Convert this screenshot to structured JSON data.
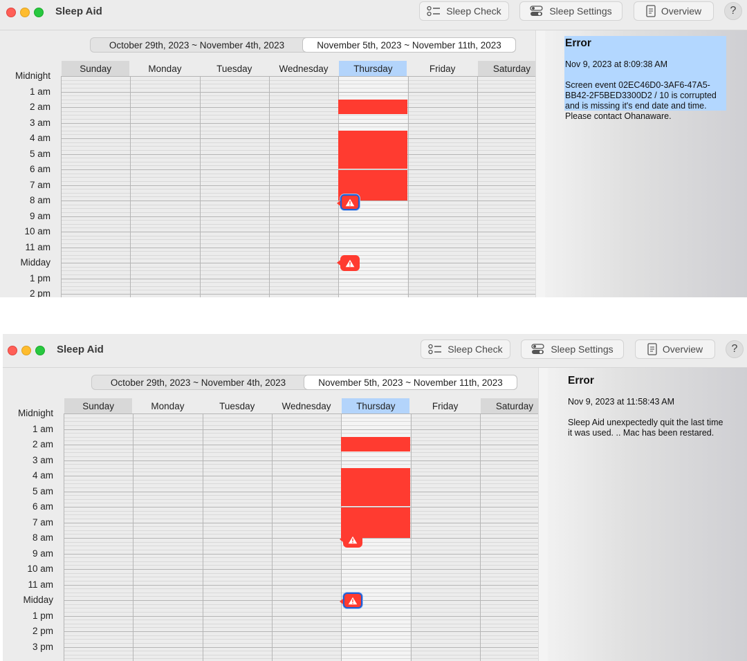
{
  "app_title": "Sleep Aid",
  "toolbar": {
    "sleep_check": "Sleep Check",
    "sleep_settings": "Sleep Settings",
    "overview": "Overview",
    "help": "?"
  },
  "weeks": [
    "October 29th, 2023 ~ November 4th, 2023",
    "November 5th, 2023 ~ November 11th, 2023"
  ],
  "selected_week": 1,
  "days": [
    "Sunday",
    "Monday",
    "Tuesday",
    "Wednesday",
    "Thursday",
    "Friday",
    "Saturday"
  ],
  "today_index": 4,
  "hours": [
    "Midnight",
    "1 am",
    "2 am",
    "3 am",
    "4 am",
    "5 am",
    "6 am",
    "7 am",
    "8 am",
    "9 am",
    "10 am",
    "11 am",
    "Midday",
    "1 pm",
    "2 pm",
    "3 pm"
  ],
  "colors": {
    "event": "#ff3b30",
    "today_header": "#b3d4fb",
    "selection": "#1d5fd6",
    "error_highlight": "#b3d7ff"
  },
  "events": [
    {
      "day": 4,
      "start_hour": 1.5,
      "end_hour": 2.45
    },
    {
      "day": 4,
      "start_hour": 3.5,
      "end_hour": 5.95
    },
    {
      "day": 4,
      "start_hour": 6.05,
      "end_hour": 8.0
    }
  ],
  "screenshots": [
    {
      "selected_warning": 0,
      "error": {
        "title": "Error",
        "date": "Nov 9, 2023 at 8:09:38 AM",
        "message": "Screen event 02EC46D0-3AF6-47A5-BB42-2F5BED3300D2 / 10 is corrupted and is missing it's end date and time. Please contact Ohanaware.",
        "highlighted": true
      }
    },
    {
      "selected_warning": 1,
      "error": {
        "title": "Error",
        "date": "Nov 9, 2023 at 11:58:43 AM",
        "message": "Sleep Aid unexpectedly quit the last time it was used. .. Mac has been restared.",
        "highlighted": false
      }
    }
  ],
  "warnings": [
    {
      "day": 4,
      "hour": 8.1,
      "icon": "warning-icon"
    },
    {
      "day": 4,
      "hour": 12.0,
      "icon": "warning-icon"
    }
  ]
}
